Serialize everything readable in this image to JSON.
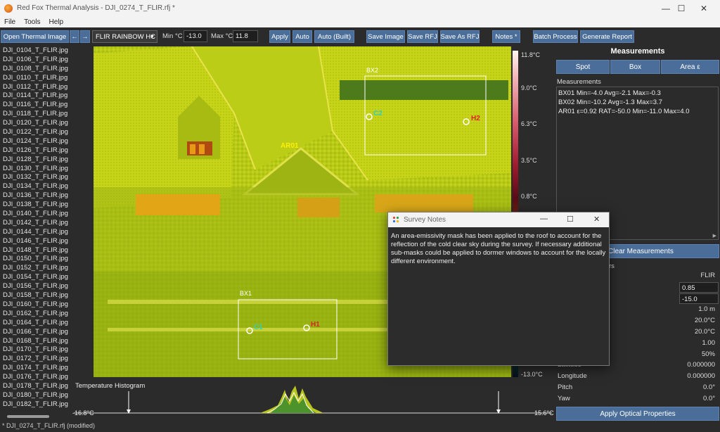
{
  "window": {
    "title": "Red Fox Thermal Analysis - DJI_0274_T_FLIR.rfj *",
    "controls": {
      "minimize": "—",
      "maximize": "☐",
      "close": "✕"
    }
  },
  "menu": [
    "File",
    "Tools",
    "Help"
  ],
  "toolbar": {
    "open_label": "Open Thermal Image",
    "prev_label": "←",
    "next_label": "→",
    "palette_value": "FLIR RAINBOW HC",
    "min_label": "Min °C",
    "min_value": "-13.0",
    "max_label": "Max °C",
    "max_value": "11.8",
    "apply_label": "Apply",
    "auto_label": "Auto",
    "auto_built_label": "Auto (Built)",
    "save_image_label": "Save Image",
    "save_rfj_label": "Save RFJ",
    "save_as_rfj_label": "Save As RFJ",
    "notes_label": "Notes *",
    "batch_label": "Batch Process",
    "report_label": "Generate Report"
  },
  "files": [
    "DJI_0104_T_FLIR.jpg",
    "DJI_0106_T_FLIR.jpg",
    "DJI_0108_T_FLIR.jpg",
    "DJI_0110_T_FLIR.jpg",
    "DJI_0112_T_FLIR.jpg",
    "DJI_0114_T_FLIR.jpg",
    "DJI_0116_T_FLIR.jpg",
    "DJI_0118_T_FLIR.jpg",
    "DJI_0120_T_FLIR.jpg",
    "DJI_0122_T_FLIR.jpg",
    "DJI_0124_T_FLIR.jpg",
    "DJI_0126_T_FLIR.jpg",
    "DJI_0128_T_FLIR.jpg",
    "DJI_0130_T_FLIR.jpg",
    "DJI_0132_T_FLIR.jpg",
    "DJI_0134_T_FLIR.jpg",
    "DJI_0136_T_FLIR.jpg",
    "DJI_0138_T_FLIR.jpg",
    "DJI_0140_T_FLIR.jpg",
    "DJI_0142_T_FLIR.jpg",
    "DJI_0144_T_FLIR.jpg",
    "DJI_0146_T_FLIR.jpg",
    "DJI_0148_T_FLIR.jpg",
    "DJI_0150_T_FLIR.jpg",
    "DJI_0152_T_FLIR.jpg",
    "DJI_0154_T_FLIR.jpg",
    "DJI_0156_T_FLIR.jpg",
    "DJI_0158_T_FLIR.jpg",
    "DJI_0160_T_FLIR.jpg",
    "DJI_0162_T_FLIR.jpg",
    "DJI_0164_T_FLIR.jpg",
    "DJI_0166_T_FLIR.jpg",
    "DJI_0168_T_FLIR.jpg",
    "DJI_0170_T_FLIR.jpg",
    "DJI_0172_T_FLIR.jpg",
    "DJI_0174_T_FLIR.jpg",
    "DJI_0176_T_FLIR.jpg",
    "DJI_0178_T_FLIR.jpg",
    "DJI_0180_T_FLIR.jpg",
    "DJI_0182_T_FLIR.jpg"
  ],
  "image": {
    "labels": {
      "ar01": "AR01",
      "bx1": "BX1",
      "bx2": "BX2",
      "c1": "C1",
      "c2": "C2",
      "h1": "H1",
      "h2": "H2"
    }
  },
  "colorbar": {
    "ticks": [
      "11.8°C",
      "9.0°C",
      "6.3°C",
      "3.5°C",
      "0.8°C",
      "-13.0°C"
    ]
  },
  "histogram": {
    "title": "Temperature Histogram",
    "min_label": "-16.8°C",
    "max_label": "15.6°C"
  },
  "status": "* DJI_0274_T_FLIR.rfj (modified)",
  "measurements_panel": {
    "title": "Measurements",
    "spot_label": "Spot",
    "box_label": "Box",
    "area_label": "Area ε",
    "list_header": "Measurements",
    "rows": [
      "BX01 Min=-4.0 Avg=-2.1 Max=-0.3",
      "BX02 Min=-10.2 Avg=-1.3 Max=3.7",
      "AR01 ε=0.92 RAT=-50.0 Min=-11.0 Max=4.0"
    ],
    "clear_label": "Clear Measurements",
    "params_header_fragment": "rs"
  },
  "optical": {
    "camera": "FLIR",
    "emissivity": "0.85",
    "reflected_temp": "-15.0",
    "distance": "1.0 m",
    "temp1": "20.0°C",
    "temp2": "20.0°C",
    "value1": "1.00",
    "humidity": "50%",
    "latitude_label": "Latitude",
    "latitude": "0.000000",
    "longitude_label": "Longitude",
    "longitude": "0.000000",
    "pitch_label": "Pitch",
    "pitch": "0.0°",
    "yaw_label": "Yaw",
    "yaw": "0.0°",
    "apply_label": "Apply Optical Properties"
  },
  "dialog": {
    "title": "Survey Notes",
    "body": "An area-emissivity mask has been applied to the roof to account for the reflection of the cold clear sky during the survey.  If necessary additional sub-masks could be applied to dormer windows to account for the locally different environment."
  }
}
